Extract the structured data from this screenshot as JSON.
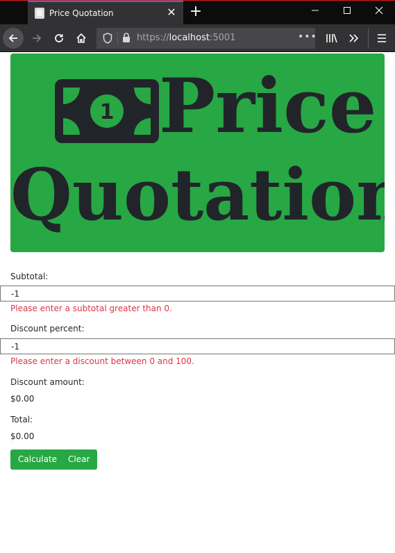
{
  "browser": {
    "tab_title": "Price Quotation",
    "url_scheme": "https://",
    "url_host": "localhost",
    "url_port": ":5001",
    "accent": "#0a84ff"
  },
  "banner": {
    "word1": "Price",
    "word2": "Quotation",
    "bg_color": "#28a745",
    "icon": "money-bill-icon",
    "icon_digit": "1"
  },
  "form": {
    "subtotal": {
      "label": "Subtotal:",
      "value": "-1",
      "error": "Please enter a subtotal greater than 0."
    },
    "discount_percent": {
      "label": "Discount percent:",
      "value": "-1",
      "error": "Please enter a discount between 0 and 100."
    },
    "discount_amount": {
      "label": "Discount amount:",
      "value": "$0.00"
    },
    "total": {
      "label": "Total:",
      "value": "$0.00"
    },
    "calculate_label": "Calculate",
    "clear_label": "Clear",
    "error_color": "#dc3545"
  }
}
